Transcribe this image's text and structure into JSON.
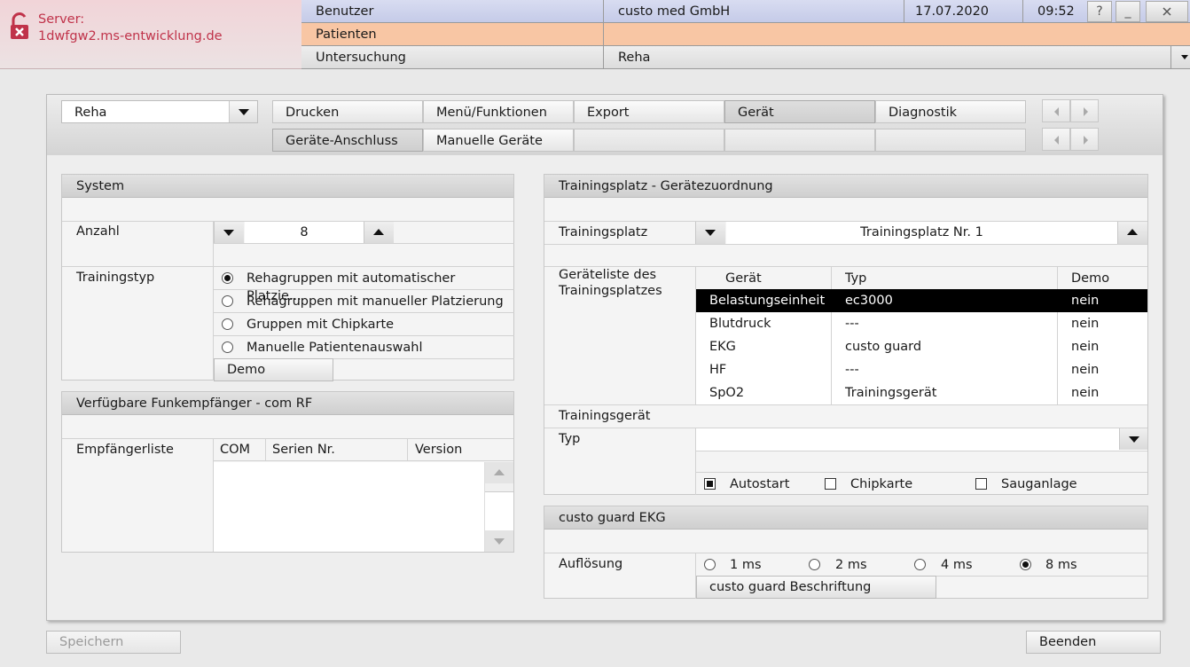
{
  "header": {
    "server_label": "Server:",
    "server_name": "1dwfgw2.ms-entwicklung.de",
    "user_label": "Benutzer",
    "user_value": "custo med GmbH",
    "date": "17.07.2020",
    "time": "09:52",
    "help_icon": "?",
    "minimize_icon": "_",
    "patient_label": "Patienten",
    "exam_label": "Untersuchung",
    "exam_value": "Reha"
  },
  "toolbar": {
    "module_select": "Reha",
    "tabs_row1": [
      "Drucken",
      "Menü/Funktionen",
      "Export",
      "Gerät",
      "Diagnostik"
    ],
    "tabs_row2": [
      "Geräte-Anschluss",
      "Manuelle Geräte"
    ],
    "active_tab": "Gerät"
  },
  "system": {
    "title": "System",
    "count_label": "Anzahl",
    "count_value": "8",
    "training_type_label": "Trainingstyp",
    "training_types": [
      "Rehagruppen mit automatischer Platzie...",
      "Rehagruppen mit manueller Platzierung",
      "Gruppen mit Chipkarte",
      "Manuelle Patientenauswahl"
    ],
    "selected_training_type": 0,
    "demo_button": "Demo"
  },
  "receivers": {
    "title": "Verfügbare Funkempfänger - com RF",
    "list_label": "Empfängerliste",
    "columns": [
      "COM",
      "Serien Nr.",
      "Version"
    ],
    "rows": []
  },
  "assignment": {
    "title": "Trainingsplatz - Gerätezuordnung",
    "place_label": "Trainingsplatz",
    "place_value": "Trainingsplatz Nr. 1",
    "device_list_label": "Geräteliste des Trainingsplatzes",
    "columns": [
      "Gerät",
      "Typ",
      "Demo"
    ],
    "rows": [
      {
        "device": "Belastungseinheit",
        "type": "ec3000",
        "demo": "nein"
      },
      {
        "device": "Blutdruck",
        "type": "---",
        "demo": "nein"
      },
      {
        "device": "EKG",
        "type": "custo guard",
        "demo": "nein"
      },
      {
        "device": "HF",
        "type": "---",
        "demo": "nein"
      },
      {
        "device": "SpO2",
        "type": "Trainingsgerät",
        "demo": "nein"
      }
    ],
    "selected_row": 0,
    "training_device_label": "Trainingsgerät",
    "type_label": "Typ",
    "type_value": "",
    "checkboxes": [
      {
        "label": "Autostart",
        "checked": true
      },
      {
        "label": "Chipkarte",
        "checked": false
      },
      {
        "label": "Sauganlage",
        "checked": false
      }
    ]
  },
  "ekg": {
    "title": "custo guard EKG",
    "resolution_label": "Auflösung",
    "resolutions": [
      "1 ms",
      "2 ms",
      "4 ms",
      "8 ms"
    ],
    "selected_resolution": 3,
    "label_button": "custo guard Beschriftung"
  },
  "footer": {
    "save_button": "Speichern",
    "end_button": "Beenden"
  },
  "colors": {
    "user_row": "#c5cbe8",
    "patient_row": "#f8c6a4",
    "server_text": "#c0334a"
  }
}
